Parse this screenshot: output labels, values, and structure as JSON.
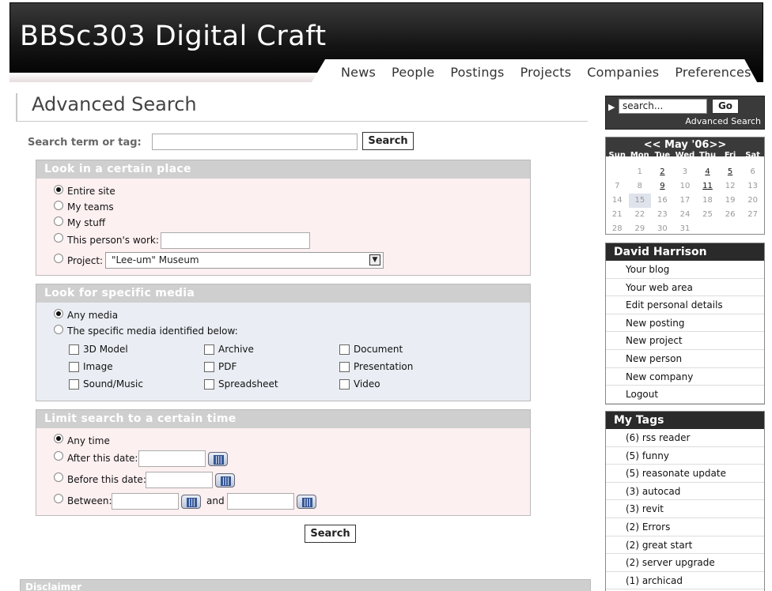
{
  "site_title": "BBSc303 Digital Craft",
  "nav": [
    "News",
    "People",
    "Postings",
    "Projects",
    "Companies",
    "Preferences"
  ],
  "page_title": "Advanced Search",
  "search": {
    "label": "Search term or tag:",
    "button": "Search"
  },
  "place_panel": {
    "title": "Look in a certain place",
    "options": [
      "Entire site",
      "My teams",
      "My stuff",
      "This person's work:",
      "Project:"
    ],
    "selected": 0,
    "project_value": "\"Lee-um\" Museum"
  },
  "media_panel": {
    "title": "Look for specific media",
    "options": [
      "Any media",
      "The specific media identified below:"
    ],
    "selected": 0,
    "types": [
      "3D Model",
      "Archive",
      "Document",
      "Image",
      "PDF",
      "Presentation",
      "Sound/Music",
      "Spreadsheet",
      "Video"
    ]
  },
  "time_panel": {
    "title": "Limit search to a certain time",
    "options": [
      "Any time",
      "After this date:",
      "Before this date:",
      "Between:"
    ],
    "selected": 0,
    "and_label": "and"
  },
  "bottom_button": "Search",
  "disclaimer": "Disclaimer",
  "sidebar": {
    "search_placeholder": "search...",
    "go": "Go",
    "advanced_link": "Advanced Search",
    "calendar": {
      "title": "<< May '06>>",
      "days": [
        "Sun",
        "Mon",
        "Tue",
        "Wed",
        "Thu",
        "Fri",
        "Sat"
      ],
      "weeks": [
        [
          "",
          "1",
          "2",
          "3",
          "4",
          "5",
          "6"
        ],
        [
          "7",
          "8",
          "9",
          "10",
          "11",
          "12",
          "13"
        ],
        [
          "14",
          "15",
          "16",
          "17",
          "18",
          "19",
          "20"
        ],
        [
          "21",
          "22",
          "23",
          "24",
          "25",
          "26",
          "27"
        ],
        [
          "28",
          "29",
          "30",
          "31",
          "",
          "",
          ""
        ]
      ],
      "linked_days": [
        "2",
        "4",
        "5",
        "9",
        "11"
      ],
      "highlighted_day": "15"
    },
    "user_box": {
      "name": "David Harrison",
      "items": [
        "Your blog",
        "Your web area",
        "Edit personal details",
        "New posting",
        "New project",
        "New person",
        "New company",
        "Logout"
      ]
    },
    "tags_box": {
      "title": "My Tags",
      "items": [
        "(6) rss reader",
        "(5) funny",
        "(5) reasonate update",
        "(3) autocad",
        "(3) revit",
        "(2) Errors",
        "(2) great start",
        "(2) server upgrade",
        "(1) archicad"
      ]
    }
  }
}
